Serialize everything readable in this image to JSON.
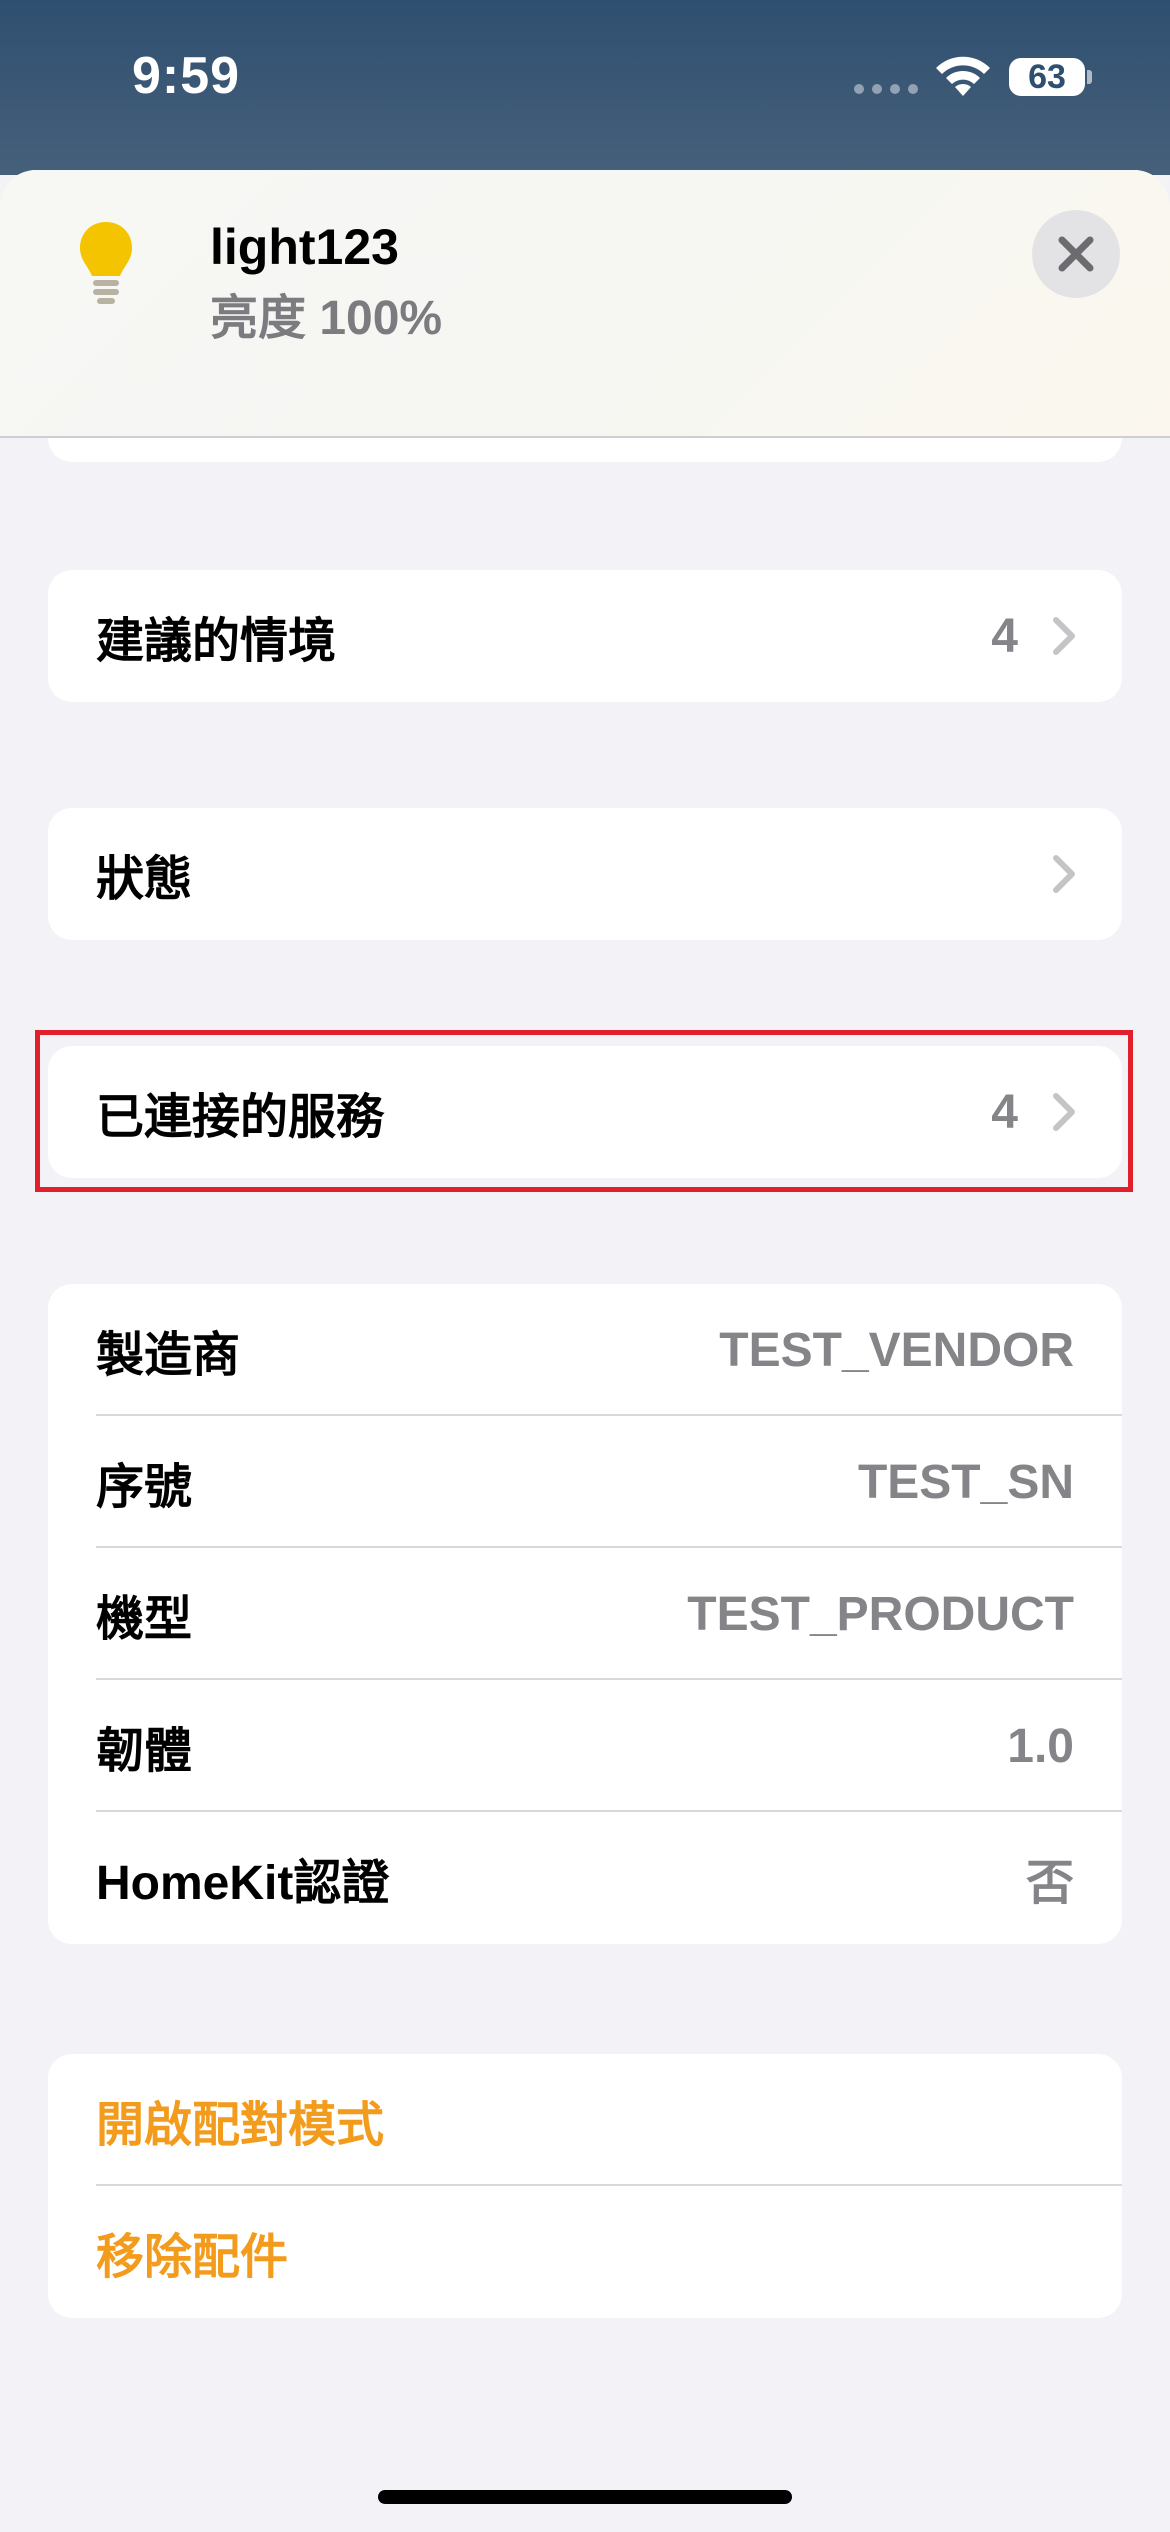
{
  "status_bar": {
    "time": "9:59",
    "battery": "63"
  },
  "accessory": {
    "name": "light123",
    "status": "亮度 100%"
  },
  "sections": {
    "suggested_scenes": {
      "label": "建議的情境",
      "count": "4"
    },
    "status": {
      "label": "狀態"
    },
    "connected_services": {
      "label": "已連接的服務",
      "count": "4"
    }
  },
  "info": [
    {
      "label": "製造商",
      "value": "TEST_VENDOR"
    },
    {
      "label": "序號",
      "value": "TEST_SN"
    },
    {
      "label": "機型",
      "value": "TEST_PRODUCT"
    },
    {
      "label": "韌體",
      "value": "1.0"
    },
    {
      "label": "HomeKit認證",
      "value": "否"
    }
  ],
  "actions": {
    "open_pairing": "開啟配對模式",
    "remove_accessory": "移除配件"
  },
  "colors": {
    "accent": "#f39b1c",
    "highlight": "#e0202c",
    "bulb": "#f5c400"
  },
  "icons": [
    "lightbulb-icon",
    "close-icon",
    "chevron-right-icon",
    "wifi-icon",
    "battery-icon"
  ]
}
